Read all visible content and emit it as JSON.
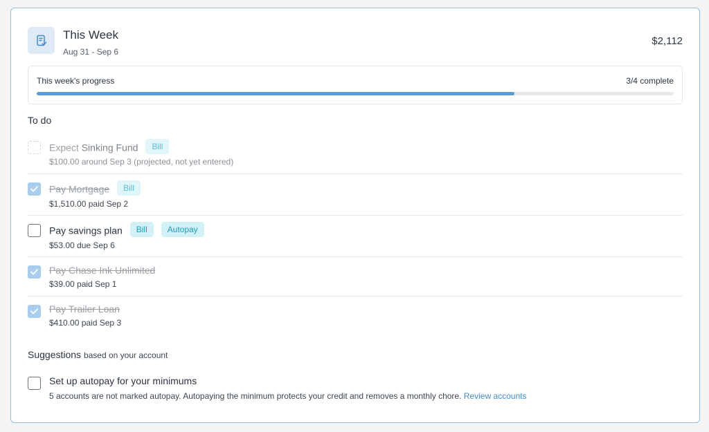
{
  "header": {
    "title": "This Week",
    "dates": "Aug 31 - Sep 6",
    "total": "$2,112",
    "icon": "receipt-check-icon"
  },
  "progress": {
    "label": "This week's progress",
    "count": "3/4 complete",
    "fraction": 0.75
  },
  "todo": {
    "title": "To do",
    "tasks": [
      {
        "name_prefix": "Expect",
        "name": "Sinking Fund",
        "badges": [
          "Bill"
        ],
        "detail": "$100.00 around Sep 3 (projected, not yet entered)",
        "state": "projected"
      },
      {
        "name": "Pay Mortgage",
        "badges": [
          "Bill"
        ],
        "detail": "$1,510.00 paid Sep 2",
        "state": "done"
      },
      {
        "name": "Pay savings plan",
        "badges": [
          "Bill",
          "Autopay"
        ],
        "detail": "$53.00 due Sep 6",
        "state": "open"
      },
      {
        "name": "Pay Chase Ink Unlimited",
        "badges": [],
        "detail": "$39.00 paid Sep 1",
        "state": "done"
      },
      {
        "name": "Pay Trailer Loan",
        "badges": [],
        "detail": "$410.00 paid Sep 3",
        "state": "done"
      }
    ]
  },
  "suggestions": {
    "title": "Suggestions",
    "subtitle": "based on your account",
    "items": [
      {
        "name": "Set up autopay for your minimums",
        "detail": "5 accounts are not marked autopay. Autopaying the minimum protects your credit and removes a monthly chore.",
        "link": "Review accounts"
      }
    ]
  },
  "colors": {
    "accent": "#5a9bd8",
    "card_border": "#8fbce3",
    "badge_text": "#1d9fbd",
    "badge_bg": "#d2f1f7"
  }
}
